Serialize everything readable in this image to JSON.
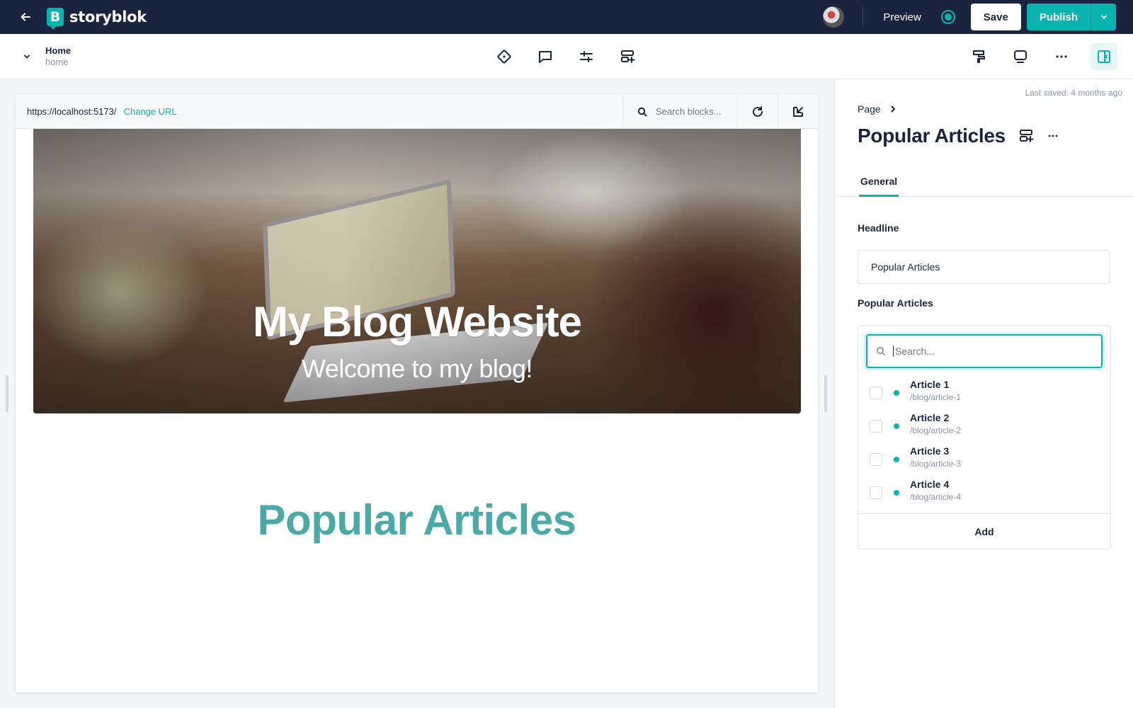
{
  "topbar": {
    "brand": "storyblok",
    "logo_letter": "B",
    "preview_label": "Preview",
    "save_label": "Save",
    "publish_label": "Publish",
    "accent_color": "#09b3af",
    "background_color": "#1b243f"
  },
  "story": {
    "title": "Home",
    "slug": "home"
  },
  "toolbar": {
    "center_icons": [
      "block-diamond-icon",
      "comment-icon",
      "sliders-icon",
      "add-block-icon"
    ],
    "right_icons": [
      "paint-roller-icon",
      "screen-icon",
      "more-icon",
      "split-panel-icon"
    ]
  },
  "preview": {
    "url": "https://localhost:5173/",
    "change_url_label": "Change URL",
    "search_placeholder": "Search blocks...",
    "hero_title": "My Blog Website",
    "hero_subtitle": "Welcome to my blog!",
    "section_title": "Popular Articles",
    "section_title_color": "#4ba9a6"
  },
  "panel": {
    "last_saved": "Last saved: 4 months ago",
    "breadcrumb": "Page",
    "block_title": "Popular Articles",
    "tab_general": "General",
    "headline_label": "Headline",
    "headline_value": "Popular Articles",
    "articles_label": "Popular Articles",
    "search_placeholder": "Search...",
    "articles": [
      {
        "name": "Article 1",
        "slug": "/blog/article-1"
      },
      {
        "name": "Article 2",
        "slug": "/blog/article-2"
      },
      {
        "name": "Article 3",
        "slug": "/blog/article-3"
      },
      {
        "name": "Article 4",
        "slug": "/blog/article-4"
      }
    ],
    "add_label": "Add"
  }
}
